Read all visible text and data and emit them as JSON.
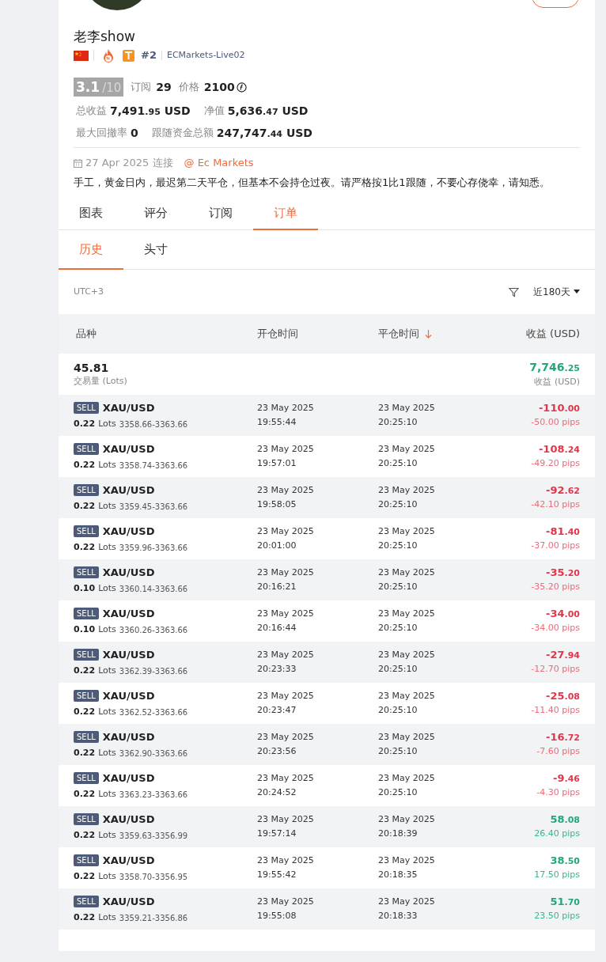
{
  "profile": {
    "name": "老李show",
    "rank": "#2",
    "server": "ECMarkets-Live02",
    "score": "3.1",
    "score_max": "/10",
    "subs_label": "订阅",
    "subs": "29",
    "price_label": "价格",
    "price": "2100",
    "total_label": "总收益",
    "total_int": "7,491",
    "total_dec": ".95",
    "total_unit": "USD",
    "equity_label": "净值",
    "equity_int": "5,636",
    "equity_dec": ".47",
    "equity_unit": "USD",
    "dd_label": "最大回撤率",
    "dd": "0",
    "follow_label": "跟随资金总额",
    "follow_int": "247,747",
    "follow_dec": ".44",
    "follow_unit": "USD",
    "date": "27 Apr 2025 连接",
    "broker": "@ Ec Markets",
    "bio": "手工，黄金日内，最迟第二天平仓，但基本不会持仓过夜。请严格按1比1跟随，不要心存侥幸，请知悉。"
  },
  "tabs": [
    {
      "label": "图表",
      "selected": false
    },
    {
      "label": "评分",
      "selected": false
    },
    {
      "label": "订阅",
      "selected": false
    },
    {
      "label": "订单",
      "selected": true
    }
  ],
  "subtabs": [
    {
      "label": "历史",
      "selected": true
    },
    {
      "label": "头寸",
      "selected": false
    }
  ],
  "timezone": "UTC+3",
  "period": "近180天",
  "table": {
    "columns": [
      "品种",
      "开仓时间",
      "平仓时间",
      "收益 (USD)"
    ],
    "summary": {
      "volume": "45.81",
      "volume_label": "交易量 (Lots)",
      "profit": "7,746.25",
      "profit_label": "收益 (USD)"
    },
    "rows": [
      {
        "side": "SELL",
        "symbol": "XAU/USD",
        "lots": "0.22",
        "lots_unit": "Lots",
        "prices": "3358.66-3363.66",
        "open_date": "23 May 2025",
        "open_time": "19:55:44",
        "close_date": "23 May 2025",
        "close_time": "20:25:10",
        "profit": "-110.00",
        "pips": "-50.00 pips",
        "positive": false
      },
      {
        "side": "SELL",
        "symbol": "XAU/USD",
        "lots": "0.22",
        "lots_unit": "Lots",
        "prices": "3358.74-3363.66",
        "open_date": "23 May 2025",
        "open_time": "19:57:01",
        "close_date": "23 May 2025",
        "close_time": "20:25:10",
        "profit": "-108.24",
        "pips": "-49.20 pips",
        "positive": false
      },
      {
        "side": "SELL",
        "symbol": "XAU/USD",
        "lots": "0.22",
        "lots_unit": "Lots",
        "prices": "3359.45-3363.66",
        "open_date": "23 May 2025",
        "open_time": "19:58:05",
        "close_date": "23 May 2025",
        "close_time": "20:25:10",
        "profit": "-92.62",
        "pips": "-42.10 pips",
        "positive": false
      },
      {
        "side": "SELL",
        "symbol": "XAU/USD",
        "lots": "0.22",
        "lots_unit": "Lots",
        "prices": "3359.96-3363.66",
        "open_date": "23 May 2025",
        "open_time": "20:01:00",
        "close_date": "23 May 2025",
        "close_time": "20:25:10",
        "profit": "-81.40",
        "pips": "-37.00 pips",
        "positive": false
      },
      {
        "side": "SELL",
        "symbol": "XAU/USD",
        "lots": "0.10",
        "lots_unit": "Lots",
        "prices": "3360.14-3363.66",
        "open_date": "23 May 2025",
        "open_time": "20:16:21",
        "close_date": "23 May 2025",
        "close_time": "20:25:10",
        "profit": "-35.20",
        "pips": "-35.20 pips",
        "positive": false
      },
      {
        "side": "SELL",
        "symbol": "XAU/USD",
        "lots": "0.10",
        "lots_unit": "Lots",
        "prices": "3360.26-3363.66",
        "open_date": "23 May 2025",
        "open_time": "20:16:44",
        "close_date": "23 May 2025",
        "close_time": "20:25:10",
        "profit": "-34.00",
        "pips": "-34.00 pips",
        "positive": false
      },
      {
        "side": "SELL",
        "symbol": "XAU/USD",
        "lots": "0.22",
        "lots_unit": "Lots",
        "prices": "3362.39-3363.66",
        "open_date": "23 May 2025",
        "open_time": "20:23:33",
        "close_date": "23 May 2025",
        "close_time": "20:25:10",
        "profit": "-27.94",
        "pips": "-12.70 pips",
        "positive": false
      },
      {
        "side": "SELL",
        "symbol": "XAU/USD",
        "lots": "0.22",
        "lots_unit": "Lots",
        "prices": "3362.52-3363.66",
        "open_date": "23 May 2025",
        "open_time": "20:23:47",
        "close_date": "23 May 2025",
        "close_time": "20:25:10",
        "profit": "-25.08",
        "pips": "-11.40 pips",
        "positive": false
      },
      {
        "side": "SELL",
        "symbol": "XAU/USD",
        "lots": "0.22",
        "lots_unit": "Lots",
        "prices": "3362.90-3363.66",
        "open_date": "23 May 2025",
        "open_time": "20:23:56",
        "close_date": "23 May 2025",
        "close_time": "20:25:10",
        "profit": "-16.72",
        "pips": "-7.60 pips",
        "positive": false
      },
      {
        "side": "SELL",
        "symbol": "XAU/USD",
        "lots": "0.22",
        "lots_unit": "Lots",
        "prices": "3363.23-3363.66",
        "open_date": "23 May 2025",
        "open_time": "20:24:52",
        "close_date": "23 May 2025",
        "close_time": "20:25:10",
        "profit": "-9.46",
        "pips": "-4.30 pips",
        "positive": false
      },
      {
        "side": "SELL",
        "symbol": "XAU/USD",
        "lots": "0.22",
        "lots_unit": "Lots",
        "prices": "3359.63-3356.99",
        "open_date": "23 May 2025",
        "open_time": "19:57:14",
        "close_date": "23 May 2025",
        "close_time": "20:18:39",
        "profit": "58.08",
        "pips": "26.40 pips",
        "positive": true
      },
      {
        "side": "SELL",
        "symbol": "XAU/USD",
        "lots": "0.22",
        "lots_unit": "Lots",
        "prices": "3358.70-3356.95",
        "open_date": "23 May 2025",
        "open_time": "19:55:42",
        "close_date": "23 May 2025",
        "close_time": "20:18:35",
        "profit": "38.50",
        "pips": "17.50 pips",
        "positive": true
      },
      {
        "side": "SELL",
        "symbol": "XAU/USD",
        "lots": "0.22",
        "lots_unit": "Lots",
        "prices": "3359.21-3356.86",
        "open_date": "23 May 2025",
        "open_time": "19:55:08",
        "close_date": "23 May 2025",
        "close_time": "20:18:33",
        "profit": "51.70",
        "pips": "23.50 pips",
        "positive": true
      }
    ]
  }
}
